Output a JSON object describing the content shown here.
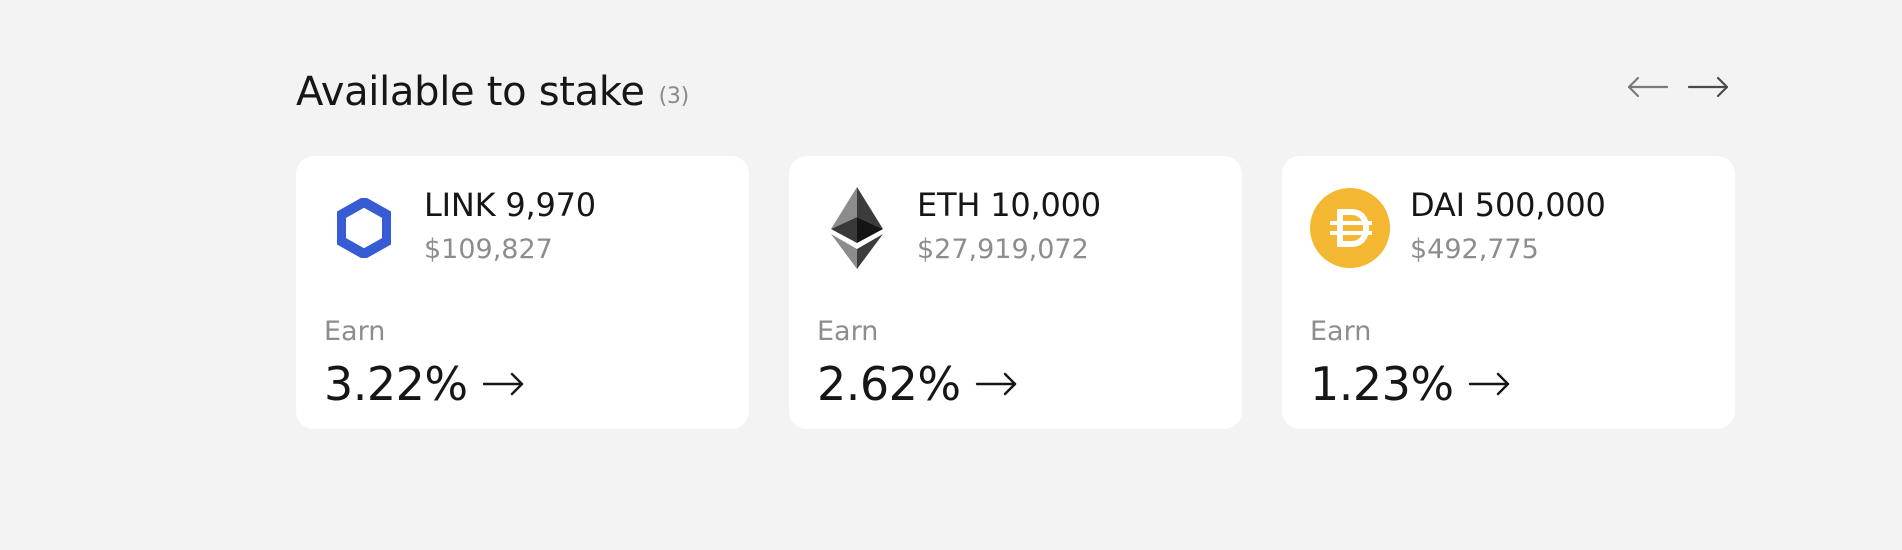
{
  "header": {
    "title": "Available to stake",
    "count": "(3)"
  },
  "nav": {
    "prev_icon": "arrow-left-icon",
    "next_icon": "arrow-right-icon"
  },
  "cards": [
    {
      "token_icon": "chainlink-icon",
      "amount": "LINK 9,970",
      "usd": "$109,827",
      "earn_label": "Earn",
      "rate": "3.22%",
      "color": "#375bd2"
    },
    {
      "token_icon": "ethereum-icon",
      "amount": "ETH 10,000",
      "usd": "$27,919,072",
      "earn_label": "Earn",
      "rate": "2.62%",
      "color": "#343434"
    },
    {
      "token_icon": "dai-icon",
      "amount": "DAI 500,000",
      "usd": "$492,775",
      "earn_label": "Earn",
      "rate": "1.23%",
      "color": "#f4b731"
    }
  ],
  "colors": {
    "background": "#f3f3f3",
    "card": "#ffffff",
    "muted_text": "#8d8d8d",
    "primary_text": "#161616"
  }
}
